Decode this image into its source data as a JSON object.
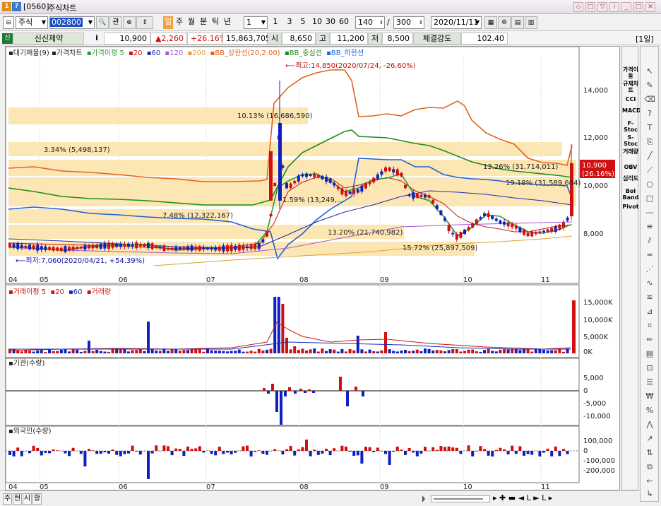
{
  "window": {
    "screen_no": "[0560]",
    "title": "주식차트"
  },
  "toolbar": {
    "market": "주식",
    "code": "002800",
    "search_btn": "관",
    "periods": [
      "일",
      "주",
      "월",
      "분",
      "틱",
      "년"
    ],
    "unit": "1",
    "minute_opts": [
      "1",
      "3",
      "5",
      "10",
      "30",
      "60"
    ],
    "count": "140",
    "total": "300",
    "date": "2020/11/11"
  },
  "quote": {
    "name": "신신제약",
    "price": "10,900",
    "change": "▲2,260",
    "rate": "+26.16%",
    "volume": "15,863,705",
    "open_label": "시",
    "open": "8,650",
    "high_label": "고",
    "high": "11,200",
    "low_label": "저",
    "low": "8,500",
    "strength_label": "체결강도",
    "strength": "102.40",
    "period_tag": "[1일]"
  },
  "legend": {
    "main": [
      "▪대기매물(9)",
      "▪가격차트",
      "▪가격이평 5",
      "▪20",
      "▪60",
      "▪120",
      "▪200",
      "▪BB_상한선(20,2.00)",
      "▪BB_중심선",
      "▪BB_하한선"
    ],
    "volume": [
      "▪거래이평 5",
      "▪20",
      "▪60",
      "▪거래량"
    ],
    "inst": "▪기관(수량)",
    "foreign": "▪외국인(수량)"
  },
  "annotations": {
    "high": "최고:14,850(2020/07/24, -26.60%)",
    "low": "최저:7,060(2020/04/21, +54.39%)",
    "current_price": "10,900",
    "current_rate": "(26.16%)"
  },
  "supply_zones": [
    {
      "label": "10.13% (16,686,590)"
    },
    {
      "label": "3.34% (5,498,137)"
    },
    {
      "label": "13.26% (31,714,011)"
    },
    {
      "label": "19.18% (31,589,604)"
    },
    {
      "label": "1.59% (13,249,…"
    },
    {
      "label": "7.48% (12,322,167)"
    },
    {
      "label": "13.20% (21,740,982)"
    },
    {
      "label": "15.72% (25,897,509)"
    }
  ],
  "price_axis": [
    "14,000",
    "12,000",
    "10,000",
    "8,000"
  ],
  "volume_axis": [
    "15,000K",
    "10,000K",
    "5,000K",
    "0K"
  ],
  "inst_axis": [
    "5,000",
    "0",
    "-5,000",
    "-10,000"
  ],
  "foreign_axis": [
    "100,000",
    "0",
    "-100,000",
    "-200,000"
  ],
  "months": [
    "04",
    "05",
    "06",
    "07",
    "08",
    "09",
    "10",
    "11"
  ],
  "right_panel": [
    "가격이동",
    "규제차트",
    "CCI",
    "MACD",
    "F-Stoc",
    "S-Stoc",
    "거래량",
    "OBV",
    "심리도",
    "Bol Band",
    "Pivot"
  ],
  "bottom_tabs": [
    "주",
    "현",
    "시",
    "황"
  ],
  "colors": {
    "up": "#d01010",
    "down": "#1020c0",
    "ma5": "#2e9a2e",
    "ma20": "#c81818",
    "ma60": "#1a2fb0",
    "bb_upper": "#e0641e",
    "bb_mid": "#1e8c1e",
    "bb_lower": "#2060d8",
    "zone": "#fbe6b4"
  },
  "chart_data": {
    "type": "candlestick",
    "x": [
      "04",
      "05",
      "06",
      "07",
      "08",
      "09",
      "10",
      "11"
    ],
    "price_range": [
      6700,
      15700
    ],
    "last_close": 10900,
    "high": 14850,
    "low": 7060
  }
}
